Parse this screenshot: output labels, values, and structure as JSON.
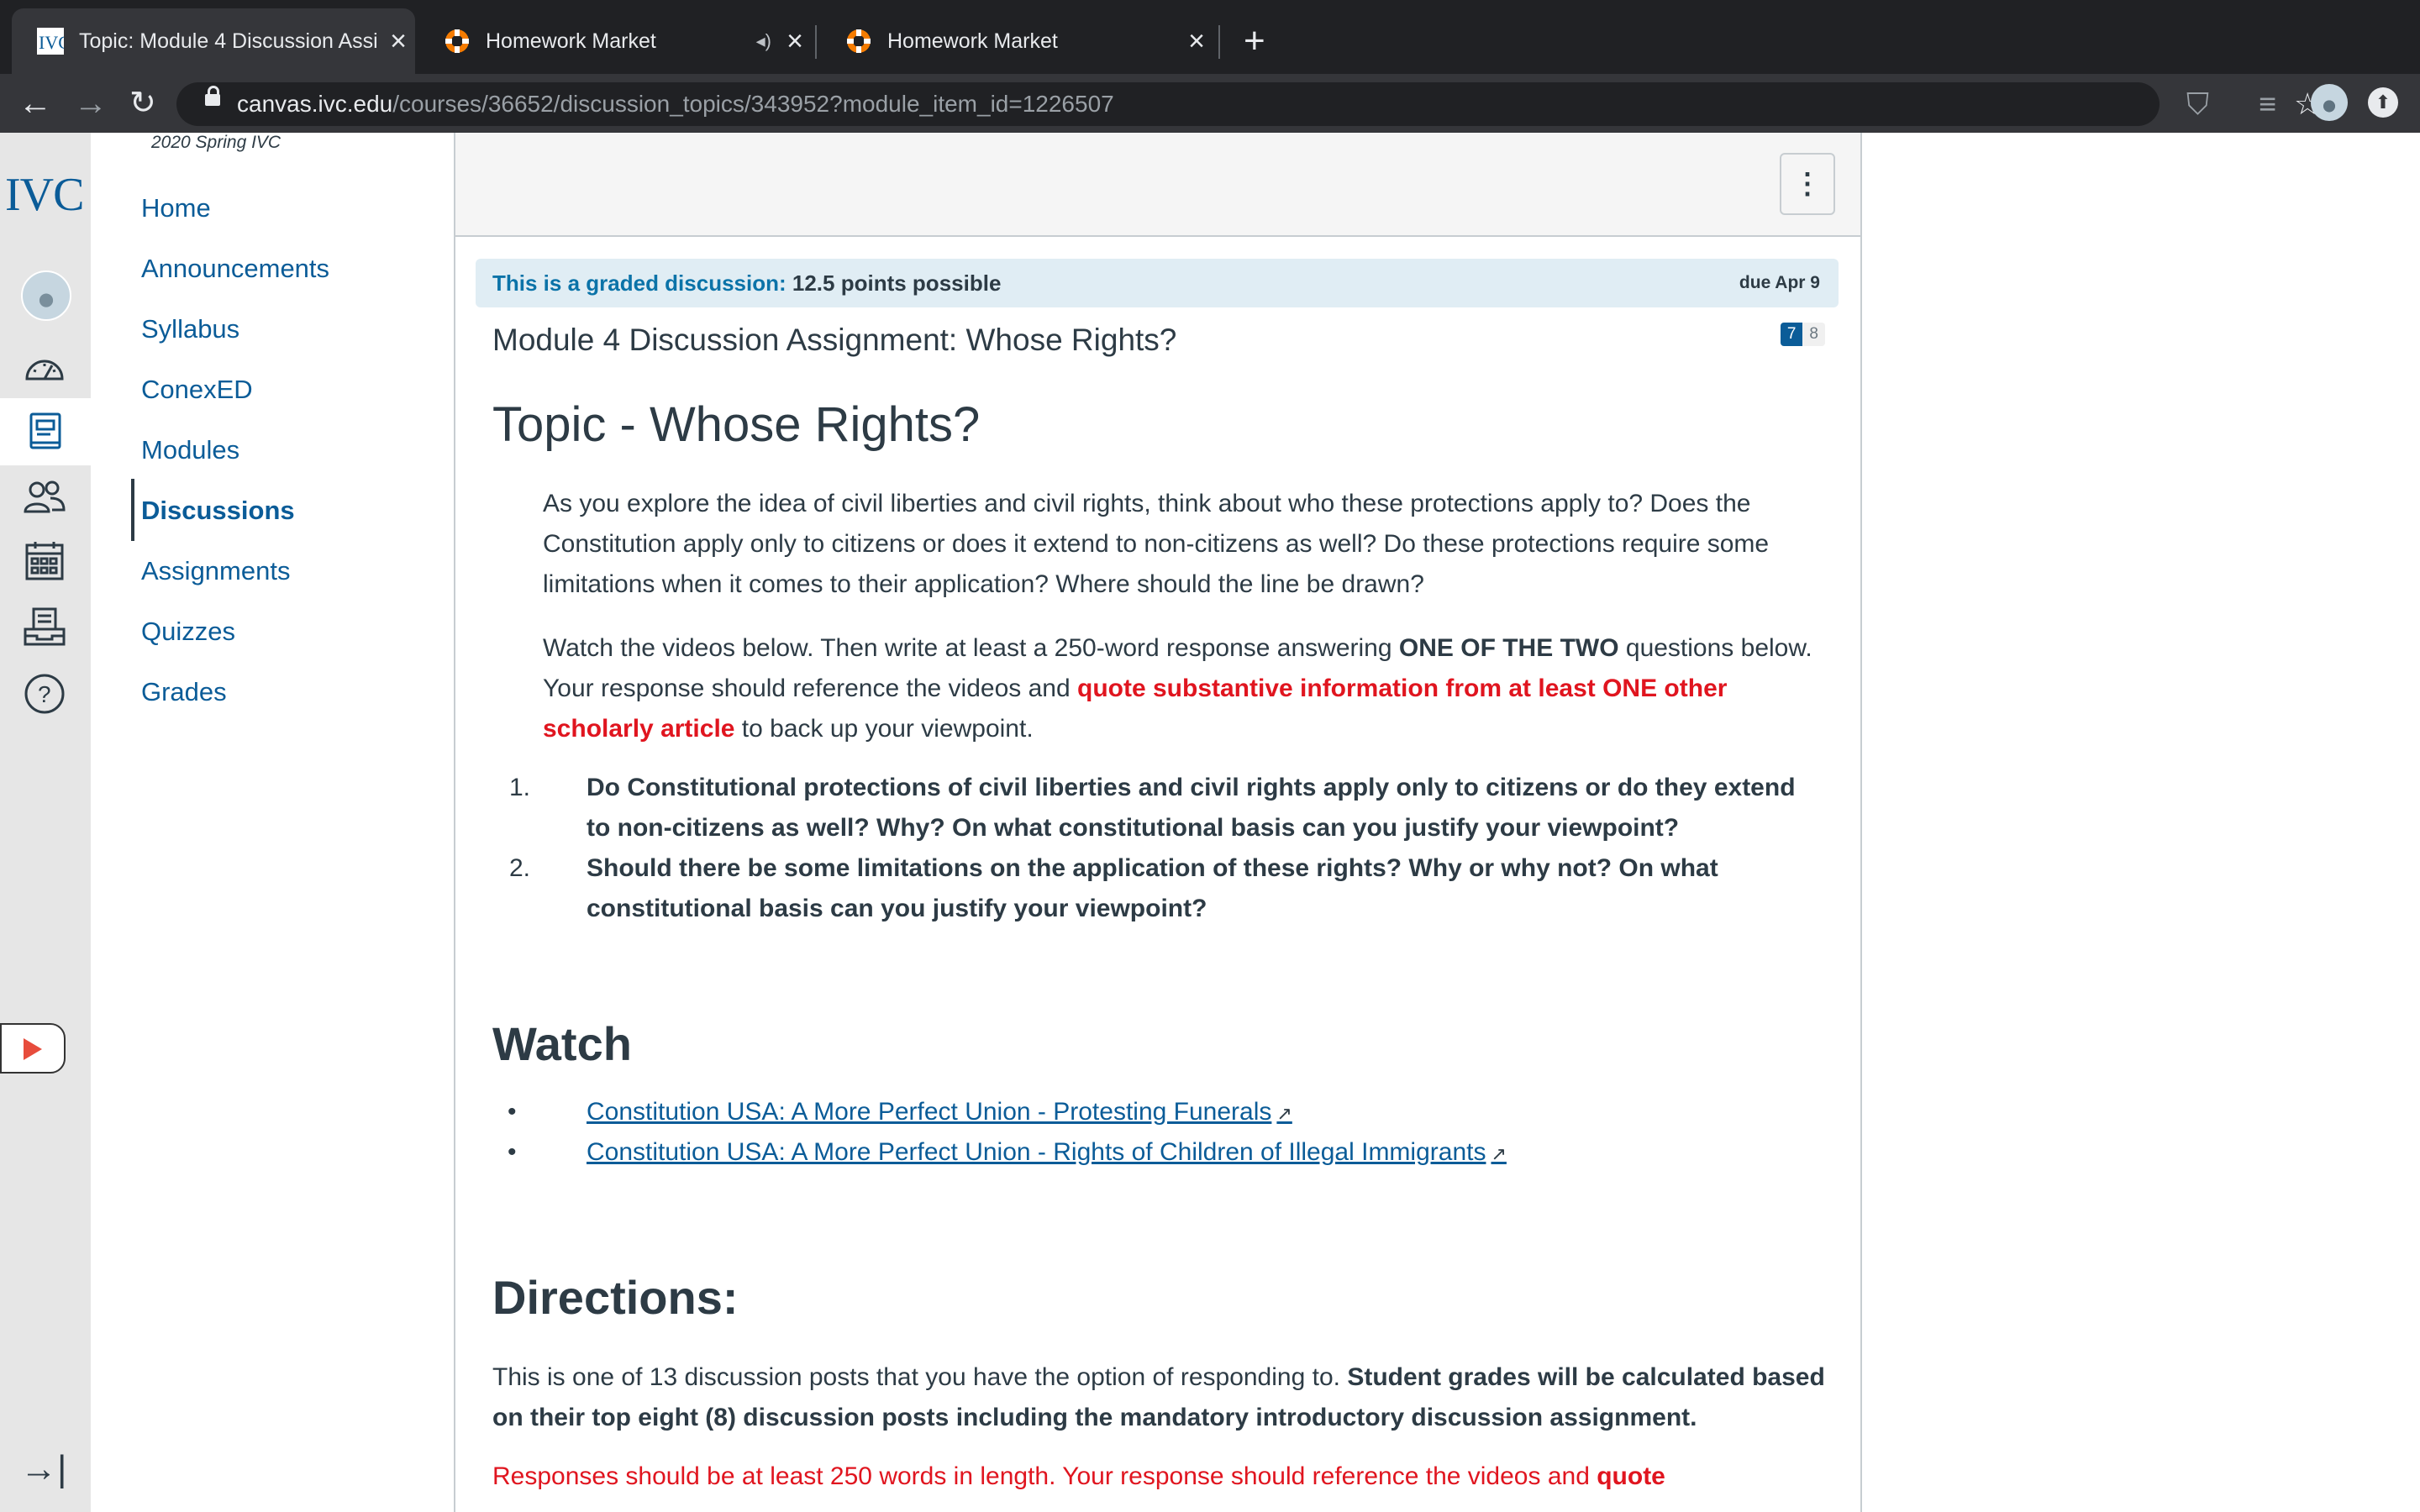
{
  "browser": {
    "tabs": [
      {
        "title": "Topic: Module 4 Discussion Assi",
        "favicon": "ivc-favicon",
        "active": true
      },
      {
        "title": "Homework Market",
        "favicon": "lifebuoy-favicon",
        "audio": true
      },
      {
        "title": "Homework Market",
        "favicon": "lifebuoy-favicon"
      }
    ],
    "url_host": "canvas.ivc.edu",
    "url_path": "/courses/36652/discussion_topics/343952?module_item_id=1226507"
  },
  "global_nav": {
    "brand": "IVC",
    "icons": [
      "avatar",
      "dashboard-icon",
      "courses-icon",
      "groups-icon",
      "calendar-icon",
      "inbox-icon",
      "help-icon"
    ]
  },
  "course_nav": {
    "term": "2020 Spring IVC",
    "items": [
      "Home",
      "Announcements",
      "Syllabus",
      "ConexED",
      "Modules",
      "Discussions",
      "Assignments",
      "Quizzes",
      "Grades"
    ],
    "active": "Discussions"
  },
  "discussion": {
    "graded_lead": "This is a graded discussion:",
    "points": "12.5 points possible",
    "due": "due Apr 9",
    "unread_count": "7",
    "total_count": "8",
    "title": "Module 4 Discussion Assignment: Whose Rights?",
    "topic_heading": "Topic - Whose Rights?",
    "intro_p1": "As you explore the idea of civil liberties and civil rights, think about who these protections apply to? Does the Constitution apply only to citizens or does it extend to non-citizens as well? Do these protections require some limitations when it comes to their application? Where should the line be drawn?",
    "intro_p2_a": "Watch the videos below. Then write at least a 250-word response answering ",
    "intro_p2_b": "ONE OF THE TWO",
    "intro_p2_c": " questions below. Your response should reference the videos and ",
    "intro_p2_d": "quote substantive information from at least ONE other scholarly article",
    "intro_p2_e": " to back up your viewpoint.",
    "questions": [
      {
        "num": "1.",
        "text": "Do Constitutional protections of civil liberties and civil rights apply only to citizens or do they extend to non-citizens as well? Why? On what constitutional basis can you justify your viewpoint?"
      },
      {
        "num": "2.",
        "text": "Should there be some limitations on the application of these rights? Why or why not? On what constitutional basis can you justify your viewpoint?"
      }
    ],
    "watch_heading": "Watch",
    "videos": [
      "Constitution USA: A More Perfect Union - Protesting Funerals",
      "Constitution USA: A More Perfect Union - Rights of Children of Illegal Immigrants"
    ],
    "directions_heading": "Directions:",
    "directions_p1_a": "This is one of 13 discussion posts that you have the option of responding to. ",
    "directions_p1_b": "Student grades will  be calculated based on their top eight (8) discussion posts including the mandatory introductory discussion assignment.",
    "directions_p2_a": "Responses should be at least 250 words in length. Your response should reference the videos and ",
    "directions_p2_b": "quote"
  },
  "colors": {
    "link": "#0b5c98",
    "emphasis_red": "#e0151f",
    "graded_bar": "#e0edf4",
    "chrome_dark": "#202124"
  }
}
